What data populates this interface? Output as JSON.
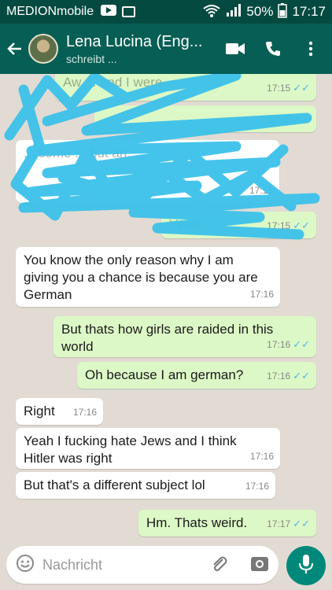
{
  "status_bar": {
    "carrier": "MEDIONmobile",
    "battery": "50%",
    "time": "17:17"
  },
  "header": {
    "contact_name": "Lena Lucina (Eng...",
    "status": "schreibt ..."
  },
  "messages": [
    {
      "dir": "out",
      "text": "Aw ... and I were",
      "time": "17:15",
      "ticks": "✓✓"
    },
    {
      "dir": "out",
      "text": "...",
      "time": "17:15",
      "ticks": "✓✓"
    },
    {
      "dir": "in",
      "text": "... some ... but an...",
      "time": "17:15"
    },
    {
      "dir": "out",
      "text": "Yeah ...",
      "time": "17:15",
      "ticks": "✓✓"
    },
    {
      "dir": "in",
      "text": "You know the only reason why I am giving you a chance is because you are German",
      "time": "17:16"
    },
    {
      "dir": "out",
      "text": "But thats how girls are raided in this world",
      "time": "17:16",
      "ticks": "✓✓"
    },
    {
      "dir": "out",
      "text": "Oh because I am german?",
      "time": "17:16",
      "ticks": "✓✓"
    },
    {
      "dir": "in",
      "text": "Right",
      "time": "17:16"
    },
    {
      "dir": "in",
      "text": "Yeah I fucking hate Jews and I think Hitler was right",
      "time": "17:16"
    },
    {
      "dir": "in",
      "text": "But that's a different subject lol",
      "time": "17:16"
    },
    {
      "dir": "out",
      "text": "Hm. Thats weird.",
      "time": "17:17",
      "ticks": "✓✓"
    }
  ],
  "composer": {
    "placeholder": "Nachricht"
  },
  "colors": {
    "header": "#075e54",
    "status_bar": "#054a40",
    "incoming": "#ffffff",
    "outgoing": "#dcf8c6",
    "read_ticks": "#4fb6ec",
    "scribble": "#3cc1ea",
    "mic": "#00897b"
  }
}
